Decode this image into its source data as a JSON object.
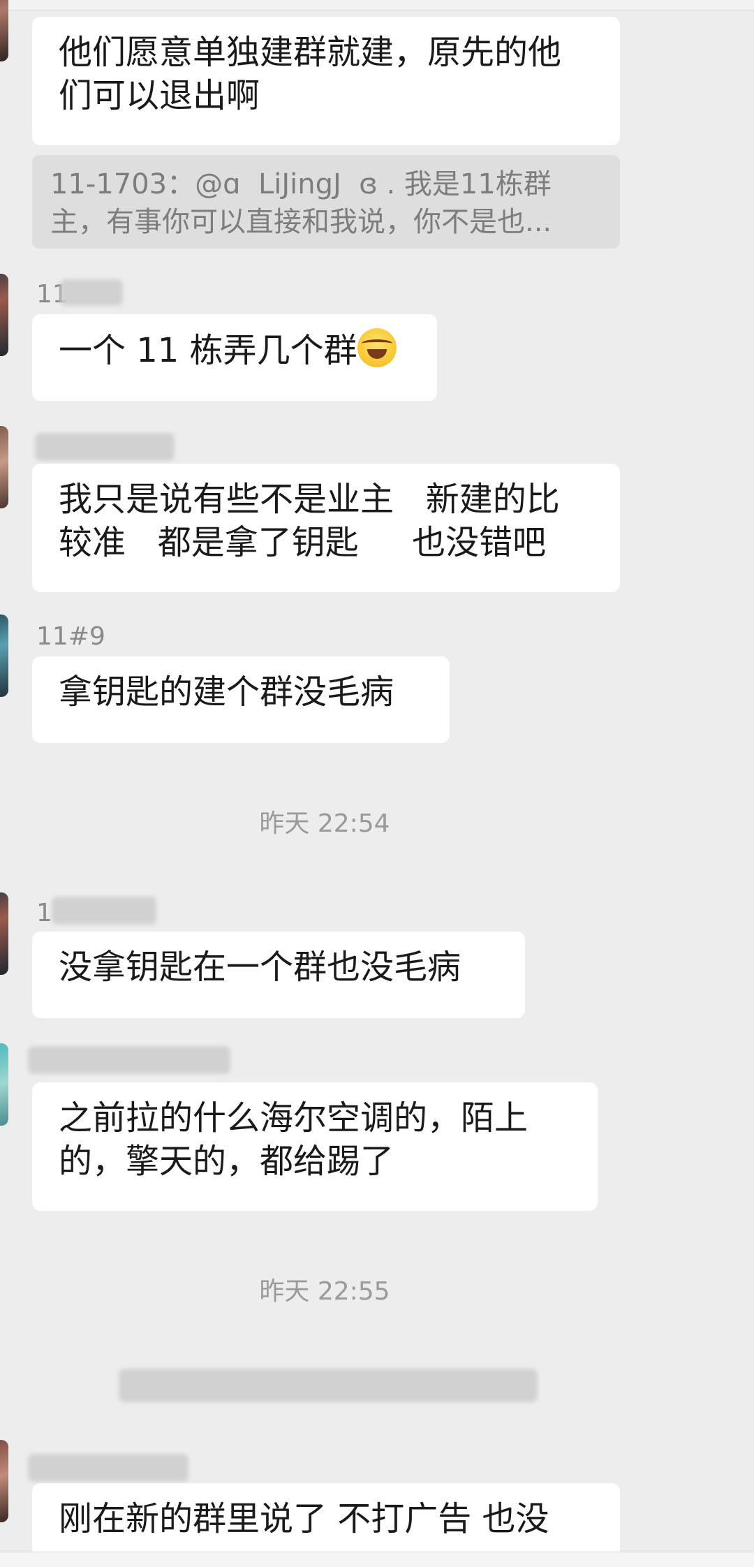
{
  "messages": [
    {
      "text": "他们愿意单独建群就建，原先的他\n们可以退出啊"
    },
    {
      "quote": "11-1703：@ɑ  LiJingJ  ɞ . 我是11栋群\n主，有事你可以直接和我说，你不是也..."
    },
    {
      "sender": "11",
      "text": "一个 11 栋弄几个群"
    },
    {
      "sender": "",
      "text": "我只是说有些不是业主   新建的比\n较准   都是拿了钥匙     也没错吧"
    },
    {
      "sender": "11#9",
      "text": "拿钥匙的建个群没毛病"
    },
    {
      "time": "昨天 22:54"
    },
    {
      "sender": "1",
      "text": "没拿钥匙在一个群也没毛病"
    },
    {
      "sender": "",
      "text": "之前拉的什么海尔空调的，陌上\n的，擎天的，都给踢了"
    },
    {
      "time": "昨天 22:55"
    },
    {
      "sender": "",
      "text": "刚在新的群里说了 不打广告 也没"
    }
  ],
  "icons": {
    "emoji": "laughing-tears-emoji-icon"
  },
  "colors": {
    "background": "#ededed",
    "bubble": "#ffffff",
    "quote_background": "#dedede",
    "text": "#1a1a1a",
    "meta_text": "#8a8a8a"
  }
}
